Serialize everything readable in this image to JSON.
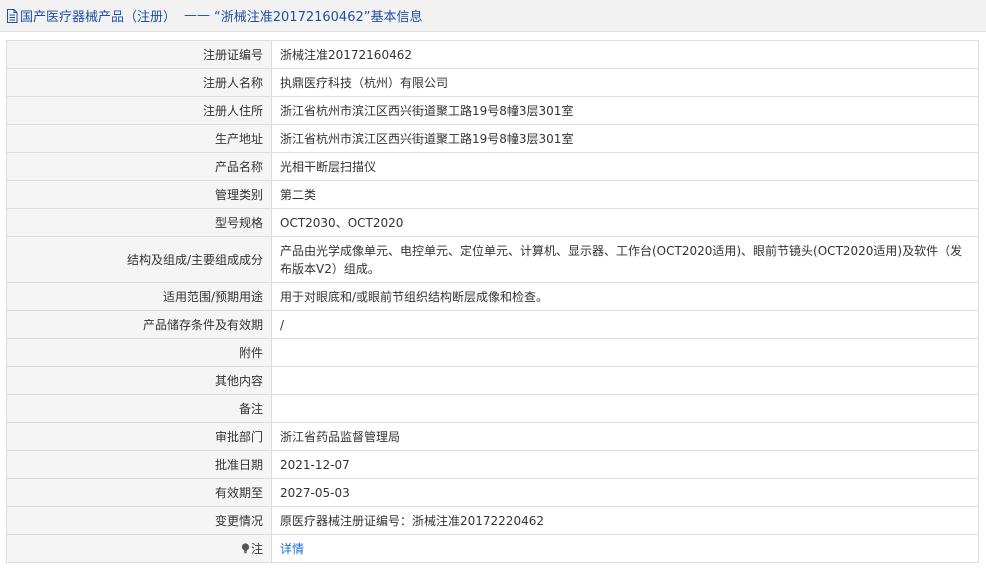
{
  "header": {
    "category": "国产医疗器械产品（注册）",
    "separator": "——",
    "title": "“浙械注准20172160462”基本信息"
  },
  "fields": [
    {
      "label": "注册证编号",
      "value": "浙械注准20172160462"
    },
    {
      "label": "注册人名称",
      "value": "执鼎医疗科技（杭州）有限公司"
    },
    {
      "label": "注册人住所",
      "value": "浙江省杭州市滨江区西兴街道聚工路19号8幢3层301室"
    },
    {
      "label": "生产地址",
      "value": "浙江省杭州市滨江区西兴街道聚工路19号8幢3层301室"
    },
    {
      "label": "产品名称",
      "value": "光相干断层扫描仪"
    },
    {
      "label": "管理类别",
      "value": "第二类"
    },
    {
      "label": "型号规格",
      "value": "OCT2030、OCT2020"
    },
    {
      "label": "结构及组成/主要组成成分",
      "value": "产品由光学成像单元、电控单元、定位单元、计算机、显示器、工作台(OCT2020适用)、眼前节镜头(OCT2020适用)及软件（发布版本V2）组成。"
    },
    {
      "label": "适用范围/预期用途",
      "value": "用于对眼底和/或眼前节组织结构断层成像和检查。"
    },
    {
      "label": "产品储存条件及有效期",
      "value": "/"
    },
    {
      "label": "附件",
      "value": ""
    },
    {
      "label": "其他内容",
      "value": ""
    },
    {
      "label": "备注",
      "value": ""
    },
    {
      "label": "审批部门",
      "value": "浙江省药品监督管理局"
    },
    {
      "label": "批准日期",
      "value": "2021-12-07"
    },
    {
      "label": "有效期至",
      "value": "2027-05-03"
    },
    {
      "label": "变更情况",
      "value": "原医疗器械注册证编号：浙械注准20172220462"
    }
  ],
  "note": {
    "label": "注",
    "link_text": "详情",
    "icon": "lightbulb-icon"
  },
  "colors": {
    "header_text": "#1e50a2",
    "link": "#1e6fd9",
    "label_bg": "#f5f5f5",
    "border": "#dddddd"
  }
}
